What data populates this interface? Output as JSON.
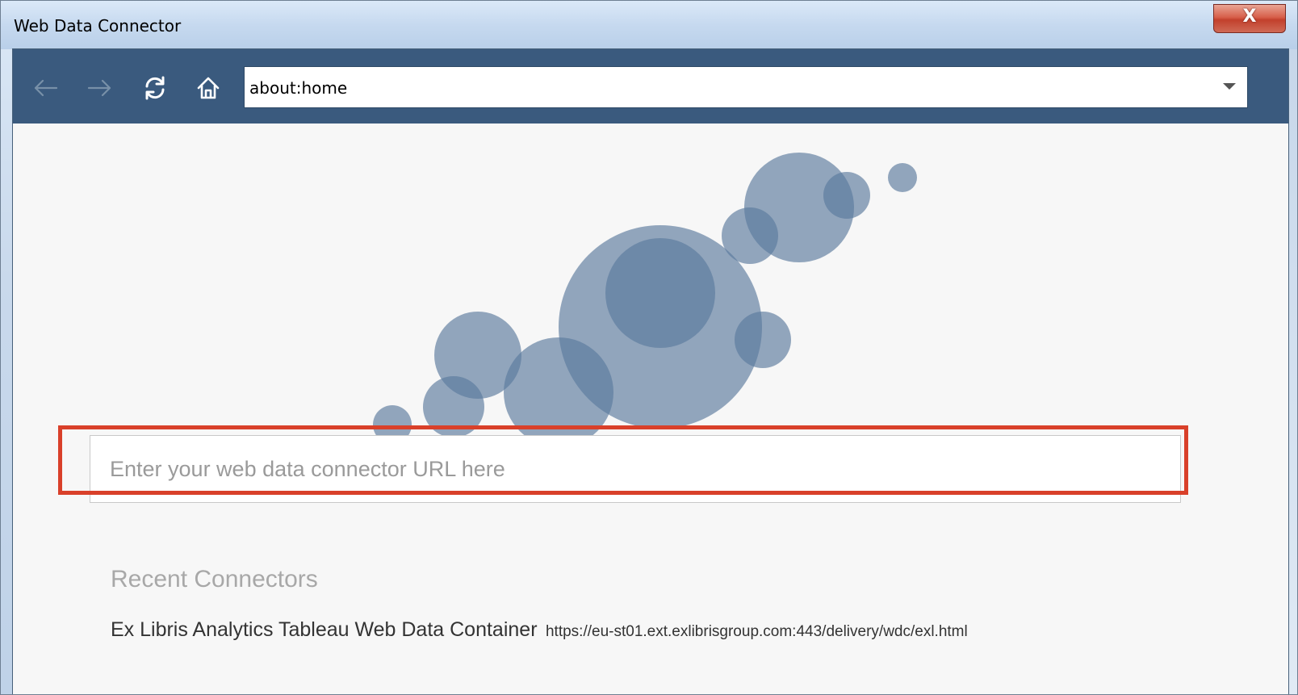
{
  "window": {
    "title": "Web Data Connector",
    "close_label": "X"
  },
  "toolbar": {
    "back_icon": "back-arrow-icon",
    "forward_icon": "forward-arrow-icon",
    "refresh_icon": "refresh-icon",
    "home_icon": "home-icon",
    "address": "about:home"
  },
  "connector": {
    "url_placeholder": "Enter your web data connector URL here",
    "url_value": ""
  },
  "recent": {
    "heading": "Recent Connectors",
    "items": [
      {
        "name": "Ex Libris Analytics Tableau Web Data Container",
        "url": "https://eu-st01.ext.exlibrisgroup.com:443/delivery/wdc/exl.html"
      }
    ]
  },
  "colors": {
    "toolbar_bg": "#3a5a7e",
    "bubble": "#5a7a9c",
    "highlight": "#d9402a"
  }
}
